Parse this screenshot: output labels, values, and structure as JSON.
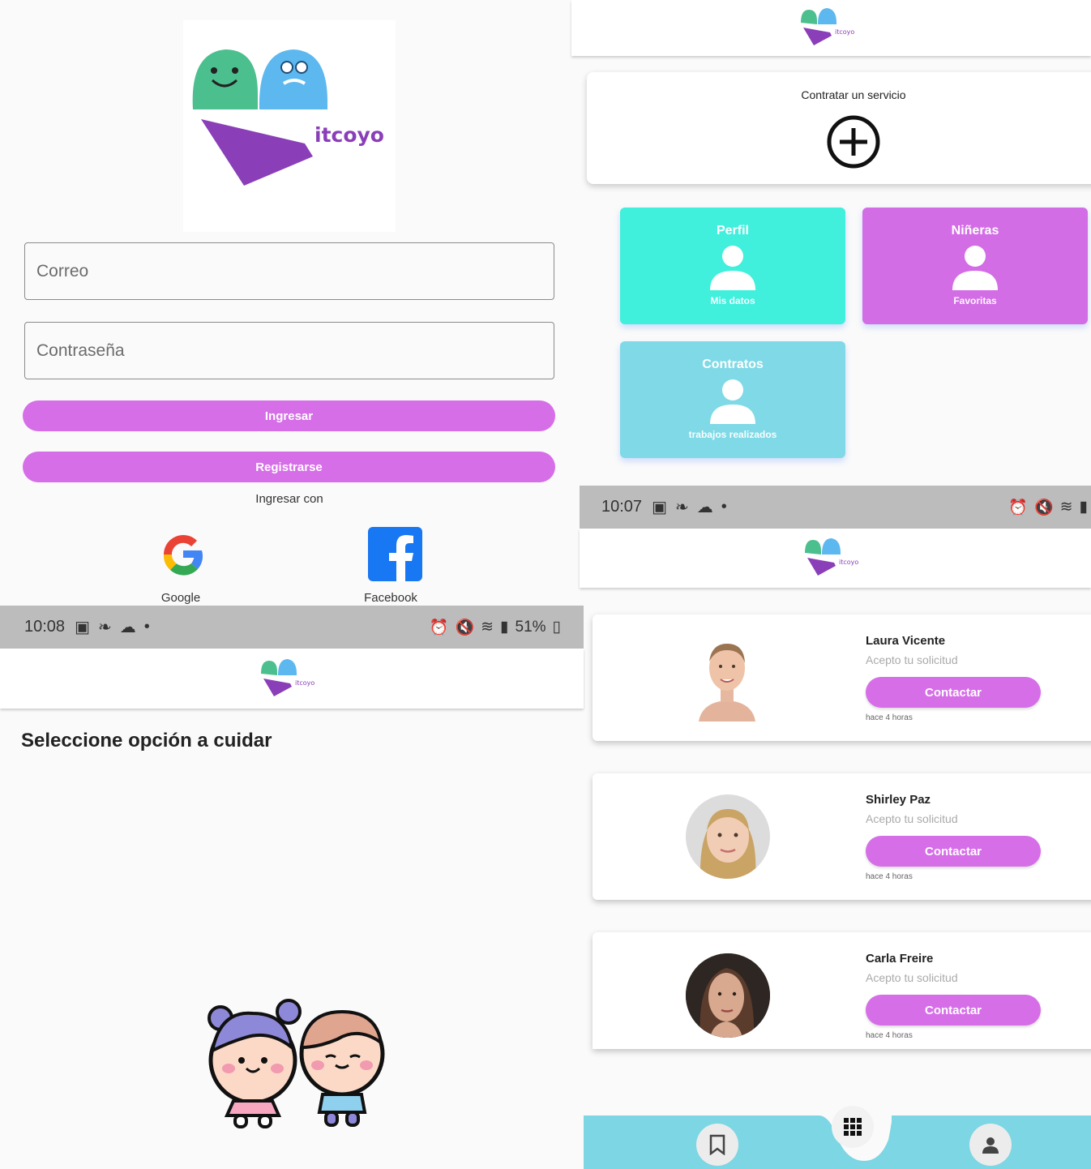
{
  "login": {
    "logo_text": "itcoyo",
    "email_placeholder": "Correo",
    "password_placeholder": "Contraseña",
    "login_button": "Ingresar",
    "register_button": "Registrarse",
    "login_with": "Ingresar con",
    "google_label": "Google",
    "facebook_label": "Facebook"
  },
  "status_bar_left": {
    "time": "10:08",
    "battery": "51%"
  },
  "status_bar_right": {
    "time": "10:07"
  },
  "dashboard": {
    "logo_text": "itcoyo",
    "hire_service": "Contratar un servicio",
    "tiles": [
      {
        "title": "Perfil",
        "subtitle": "Mis datos",
        "color": "#40efdc"
      },
      {
        "title": "Niñeras",
        "subtitle": "Favoritas",
        "color": "#d36de6"
      },
      {
        "title": "Contratos",
        "subtitle": "trabajos realizados",
        "color": "#7fd9e6"
      }
    ]
  },
  "choose": {
    "logo_text": "itcoyo",
    "title": "Seleccione opción a cuidar"
  },
  "nannies": {
    "logo_text": "itcoyo",
    "items": [
      {
        "name": "Laura Vicente",
        "status": "Acepto tu solicitud",
        "button": "Contactar",
        "time": "hace 4 horas"
      },
      {
        "name": "Shirley Paz",
        "status": "Acepto tu solicitud",
        "button": "Contactar",
        "time": "hace 4 horas"
      },
      {
        "name": "Carla Freire",
        "status": "Acepto tu solicitud",
        "button": "Contactar",
        "time": "hace 4 horas"
      }
    ]
  },
  "colors": {
    "accent": "#d66ee8",
    "teal": "#40efdc",
    "cyan": "#7fd9e6",
    "statusbar": "#bcbcbc"
  }
}
